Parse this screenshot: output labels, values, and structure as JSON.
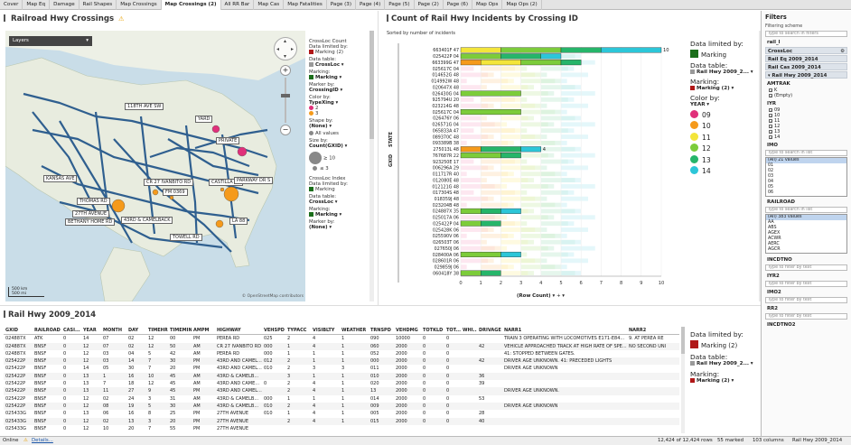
{
  "tabs": [
    {
      "label": "Cover"
    },
    {
      "label": "Map Eq"
    },
    {
      "label": "Damage"
    },
    {
      "label": "Rail Shapes"
    },
    {
      "label": "Map Crossings"
    },
    {
      "label": "Map Crossings (2)",
      "active": true
    },
    {
      "label": "All RR Bar"
    },
    {
      "label": "Map Cas"
    },
    {
      "label": "Map Fatalities"
    },
    {
      "label": "Page (3)"
    },
    {
      "label": "Page (4)"
    },
    {
      "label": "Page (5)"
    },
    {
      "label": "Page (2)"
    },
    {
      "label": "Page (6)"
    },
    {
      "label": "Map Ops"
    },
    {
      "label": "Map Ops (2)"
    }
  ],
  "map": {
    "title": "Railroad Hwy Crossings",
    "warning_icon": "warning-icon",
    "layers_label": "Layers",
    "scale_km": "500 km",
    "scale_mi": "500 mi",
    "attribution": "© OpenStreetMap contributors",
    "labels": [
      "118TH AVE SW",
      "YARD",
      "PRIVATE",
      "KANSAS AVE",
      "CR 27 IVANBITO RD",
      "CASTILLA ST",
      "PARKWAY DR S",
      "FM 0369",
      "THOMAS RD",
      "27TH AVENUE",
      "BETHANY HOME RD",
      "43RD & CAMELBACK",
      "LA 88",
      "TOWELL RD"
    ],
    "colors": {
      "rail": "#2f5f8f",
      "accent_pink": "#e0307a",
      "accent_orange": "#f59a1b",
      "water": "#c9dde8",
      "land": "#e8ecdf"
    }
  },
  "map_legend": {
    "title": "CrossLoc Count",
    "data_limited_label": "Data limited by:",
    "data_limited_value": "Marking (2)",
    "data_table_label": "Data table:",
    "data_table_value": "CrossLoc",
    "marking_label": "Marking:",
    "marking_value": "Marking",
    "marker_by_label": "Marker by:",
    "marker_by_value": "CrossingID",
    "color_by_label": "Color by:",
    "color_by_value": "TypeXing",
    "color_items": [
      {
        "label": "2",
        "color": "#e0307a"
      },
      {
        "label": "3",
        "color": "#f59a1b"
      }
    ],
    "shape_label": "Shape by:",
    "shape_value": "(None)",
    "all_values": "All values",
    "size_label": "Size by:",
    "size_value": "Count(GXID)",
    "size_big": "≥ 10",
    "size_small": "≤ 3",
    "index_title": "CrossLoc Index",
    "index_data_limited_label": "Data limited by:",
    "index_data_limited_value": "Marking",
    "index_data_table_label": "Data table:",
    "index_data_table_value": "CrossLoc",
    "index_marking_label": "Marking:",
    "index_marking_value": "Marking",
    "index_marker_label": "Marker by:",
    "index_marker_value": "(None)"
  },
  "bar_panel": {
    "title": "Count of Rail Hwy Incidents by Crossing ID",
    "sort_note": "Sorted by number of incidents",
    "x_axis_label": "(Row Count)",
    "y_axis_labels": [
      "STATE",
      "GXID"
    ],
    "legend": {
      "data_limited_label": "Data limited by:",
      "data_limited_value": "Marking",
      "data_table_label": "Data table:",
      "data_table_value": "Rail Hwy 2009_2...",
      "marking_label": "Marking:",
      "marking_value": "Marking (2)",
      "color_by_label": "Color by:",
      "color_by_value": "YEAR",
      "items": [
        {
          "label": "09",
          "color": "#e0307a"
        },
        {
          "label": "10",
          "color": "#f59a1b"
        },
        {
          "label": "11",
          "color": "#f3e53a"
        },
        {
          "label": "12",
          "color": "#7ccc3a"
        },
        {
          "label": "13",
          "color": "#26b56a"
        },
        {
          "label": "14",
          "color": "#2cc6d8"
        }
      ]
    }
  },
  "chart_data": {
    "type": "bar",
    "orientation": "horizontal",
    "stacked": true,
    "title": "Count of Rail Hwy Incidents by Crossing ID",
    "xlabel": "(Row Count)",
    "xlim": [
      0,
      10
    ],
    "xticks": [
      0,
      1,
      2,
      3,
      4,
      5,
      6,
      7,
      8,
      9,
      10
    ],
    "categories": [
      "663401F 47",
      "025422P 04",
      "663399G 47",
      "025617C 04",
      "014652G 48",
      "014992W 48",
      "020647X 48",
      "026430G 04",
      "925794U 20",
      "023214G 48",
      "025617C 04",
      "026476Y 06",
      "026571G 04",
      "065833A 47",
      "089370C 48",
      "093389B 38",
      "275013L 48",
      "767687R 22",
      "923250E 17",
      "006296A 29",
      "011717R 40",
      "012080E 48",
      "012121G 48",
      "017304S 48",
      "018359J 48",
      "023204B 48",
      "024887X 35",
      "025017A 06",
      "025422P 04",
      "025428K 06",
      "025590V 06",
      "026503T 06",
      "027650J 06",
      "028400A 06",
      "028601R 06",
      "029859J 06",
      "060418Y 38"
    ],
    "bar_labels": [
      {
        "index": 0,
        "value": 10
      },
      {
        "index": 16,
        "value": 4
      }
    ],
    "series": [
      {
        "name": "09",
        "values": [
          0,
          0,
          0,
          0,
          0,
          0,
          0,
          0,
          0,
          0,
          0,
          0,
          0,
          0,
          0,
          0,
          0,
          0,
          0,
          0,
          0,
          0,
          0,
          0,
          0,
          0,
          0,
          0,
          0,
          0,
          0,
          0,
          0,
          0,
          0,
          0,
          0
        ]
      },
      {
        "name": "10",
        "values": [
          0,
          0,
          1,
          0,
          0,
          0,
          0,
          0,
          0,
          0,
          0,
          0,
          0,
          0,
          0,
          0,
          1,
          0,
          0,
          0,
          0,
          0,
          0,
          0,
          0,
          0,
          0,
          0,
          0,
          0,
          0,
          0,
          0,
          0,
          0,
          0,
          0
        ]
      },
      {
        "name": "11",
        "values": [
          2,
          0,
          2,
          0,
          0,
          0,
          0,
          0,
          0,
          0,
          0,
          0,
          0,
          0,
          0,
          0,
          0,
          0,
          0,
          0,
          0,
          0,
          0,
          0,
          0,
          0,
          0,
          0,
          0,
          0,
          0,
          0,
          0,
          0,
          0,
          0,
          0
        ]
      },
      {
        "name": "12",
        "values": [
          3,
          2,
          2,
          0,
          0,
          0,
          0,
          3,
          0,
          0,
          3,
          0,
          0,
          0,
          0,
          0,
          0,
          2,
          0,
          0,
          0,
          0,
          0,
          0,
          0,
          0,
          1,
          0,
          1,
          0,
          0,
          0,
          0,
          2,
          0,
          0,
          1
        ]
      },
      {
        "name": "13",
        "values": [
          2,
          2,
          1,
          0,
          0,
          0,
          0,
          0,
          0,
          0,
          0,
          0,
          0,
          0,
          0,
          0,
          2,
          1,
          0,
          0,
          0,
          0,
          0,
          0,
          0,
          0,
          1,
          0,
          1,
          0,
          0,
          0,
          0,
          0,
          0,
          0,
          1
        ]
      },
      {
        "name": "14",
        "values": [
          3,
          1,
          0,
          0,
          0,
          0,
          0,
          0,
          0,
          0,
          0,
          0,
          0,
          0,
          0,
          0,
          1,
          0,
          0,
          0,
          0,
          0,
          0,
          0,
          0,
          0,
          1,
          0,
          0,
          0,
          0,
          0,
          0,
          1,
          0,
          0,
          0
        ]
      }
    ],
    "faded_background": "unmarked rows shown as faint pastel bands"
  },
  "table_panel": {
    "title": "Rail Hwy 2009_2014",
    "columns": [
      "GXID",
      "RAILROAD",
      "CASI...",
      "YEAR",
      "MONTH",
      "DAY",
      "TIMEHR",
      "TIMEMIN",
      "AMPM",
      "HIGHWAY",
      "VEHSPD",
      "TYPACC",
      "VISIBLTY",
      "WEATHER",
      "TRNSPD",
      "VEHDMG",
      "TOTKLD",
      "TOT...",
      "WHI...",
      "DRIVAGE",
      "NARR1",
      "NARR2"
    ],
    "rows": [
      [
        "024887X",
        "ATK",
        "0",
        "14",
        "07",
        "02",
        "12",
        "00",
        "PM",
        "PEREA RD",
        "025",
        "2",
        "4",
        "1",
        "090",
        "10000",
        "0",
        "0",
        "",
        "",
        "TRAIN 3 OPERATING WITH LOCOMOTIVES E171-E84...",
        "9. AT PEREA RE"
      ],
      [
        "024887X",
        "BNSF",
        "0",
        "12",
        "07",
        "02",
        "12",
        "50",
        "AM",
        "CR 27 IVANBITO RD",
        "000",
        "1",
        "4",
        "1",
        "060",
        "2000",
        "0",
        "0",
        "",
        "42",
        "VEHICLE APPROACHED TRACK AT HIGH RATE OF SPE...",
        "NO SECOND UNI"
      ],
      [
        "024887X",
        "BNSF",
        "0",
        "12",
        "03",
        "04",
        "5",
        "42",
        "AM",
        "PEREA RD",
        "000",
        "1",
        "1",
        "1",
        "052",
        "2000",
        "0",
        "0",
        "",
        "",
        "41: STOPPED BETWEEN GATES.",
        ""
      ],
      [
        "025422P",
        "BNSF",
        "0",
        "12",
        "03",
        "14",
        "7",
        "30",
        "PM",
        "43RD AND CAMEL...",
        "012",
        "2",
        "1",
        "1",
        "000",
        "2000",
        "0",
        "0",
        "",
        "42",
        "DRIVER AGE UNKNOWN. 41: PRECEDED LIGHTS",
        ""
      ],
      [
        "025422P",
        "BNSF",
        "0",
        "14",
        "05",
        "30",
        "7",
        "20",
        "PM",
        "43RD AND CAMEL...",
        "010",
        "2",
        "3",
        "3",
        "011",
        "2000",
        "0",
        "0",
        "",
        "",
        "DRIVER AGE UNKNOWN",
        ""
      ],
      [
        "025422P",
        "BNSF",
        "0",
        "13",
        "1",
        "16",
        "10",
        "45",
        "AM",
        "43RD & CAMELB...",
        "",
        "3",
        "1",
        "1",
        "010",
        "2000",
        "0",
        "0",
        "",
        "36",
        "",
        ""
      ],
      [
        "025422P",
        "BNSF",
        "0",
        "13",
        "7",
        "18",
        "12",
        "45",
        "AM",
        "43RD AND CAME...",
        "0",
        "2",
        "4",
        "1",
        "020",
        "2000",
        "0",
        "0",
        "",
        "39",
        "",
        ""
      ],
      [
        "025422P",
        "BNSF",
        "0",
        "13",
        "11",
        "27",
        "9",
        "45",
        "PM",
        "43RD AND CAMEL...",
        "",
        "2",
        "4",
        "1",
        "13",
        "2000",
        "0",
        "0",
        "",
        "",
        "DRIVER AGE UNKNOWN.",
        ""
      ],
      [
        "025422P",
        "BNSF",
        "0",
        "12",
        "02",
        "24",
        "3",
        "31",
        "AM",
        "43RD & CAMELB...",
        "000",
        "1",
        "1",
        "1",
        "014",
        "2000",
        "0",
        "0",
        "",
        "53",
        "",
        ""
      ],
      [
        "025422P",
        "BNSF",
        "0",
        "12",
        "08",
        "19",
        "5",
        "30",
        "AM",
        "43RD & CAMELB...",
        "010",
        "2",
        "4",
        "1",
        "009",
        "2000",
        "0",
        "0",
        "",
        "",
        "DRIVER AGE UNKNOWN",
        ""
      ],
      [
        "025433G",
        "BNSF",
        "0",
        "13",
        "06",
        "16",
        "8",
        "25",
        "PM",
        "27TH AVENUE",
        "010",
        "1",
        "4",
        "1",
        "005",
        "2000",
        "0",
        "0",
        "",
        "28",
        "",
        ""
      ],
      [
        "025433G",
        "BNSF",
        "0",
        "12",
        "02",
        "13",
        "3",
        "20",
        "PM",
        "27TH AVENUE",
        "",
        "2",
        "4",
        "1",
        "015",
        "2000",
        "0",
        "0",
        "",
        "40",
        "",
        ""
      ],
      [
        "025433G",
        "BNSF",
        "0",
        "12",
        "10",
        "20",
        "7",
        "55",
        "PM",
        "27TH AVENUE",
        "",
        "",
        "",
        "",
        "",
        "",
        "",
        "",
        "",
        "",
        "",
        ""
      ]
    ],
    "legend": {
      "data_limited_label": "Data limited by:",
      "data_limited_value": "Marking (2)",
      "data_table_label": "Data table:",
      "data_table_value": "Rail Hwy 2009_2...",
      "marking_label": "Marking:",
      "marking_value": "Marking (2)"
    }
  },
  "filters": {
    "title": "Filters",
    "scheme_label": "Filtering scheme",
    "search_placeholder": "Type to search in filters",
    "scheme_value": "rail_l",
    "tables": [
      "CrossLoc",
      "Rail Eq 2009_2014",
      "Rail Cas 2009_2014",
      "Rail Hwy 2009_2014"
    ],
    "amtrak_label": "AMTRAK",
    "amtrak_items": [
      {
        "label": "K",
        "checked": true
      },
      {
        "label": "(Empty)",
        "checked": true
      }
    ],
    "iyr_label": "IYR",
    "iyr_items": [
      {
        "label": "09",
        "checked": true
      },
      {
        "label": "10",
        "checked": true
      },
      {
        "label": "11",
        "checked": true
      },
      {
        "label": "12",
        "checked": true
      },
      {
        "label": "13",
        "checked": true
      },
      {
        "label": "14",
        "checked": true
      }
    ],
    "imo_label": "IMO",
    "imo_search": "Type to search in list",
    "imo_items": [
      "(All) 21 values",
      "01",
      "02",
      "03",
      "04",
      "05",
      "06"
    ],
    "railroad_label": "RAILROAD",
    "railroad_search": "Type to search in list",
    "railroad_items": [
      "(All) 383 values",
      "AA",
      "ABS",
      "AGEX",
      "ACWR",
      "AERC",
      "AGCR"
    ],
    "incdtno_label": "INCDTNO",
    "incdtno_search": "Type to filter by text",
    "iyr2_label": "IYR2",
    "iyr2_search": "Type to filter by text",
    "imo2_label": "IMO2",
    "imo2_search": "Type to filter by text",
    "rr2_label": "RR2",
    "rr2_search": "Type to filter by text",
    "incdtno2_label": "INCDTNO2"
  },
  "status": {
    "online": "Online",
    "details": "Details...",
    "rows": "12,424 of 12,424 rows",
    "marked": "55 marked",
    "columns": "103 columns",
    "table": "Rail Hwy 2009_2014"
  }
}
